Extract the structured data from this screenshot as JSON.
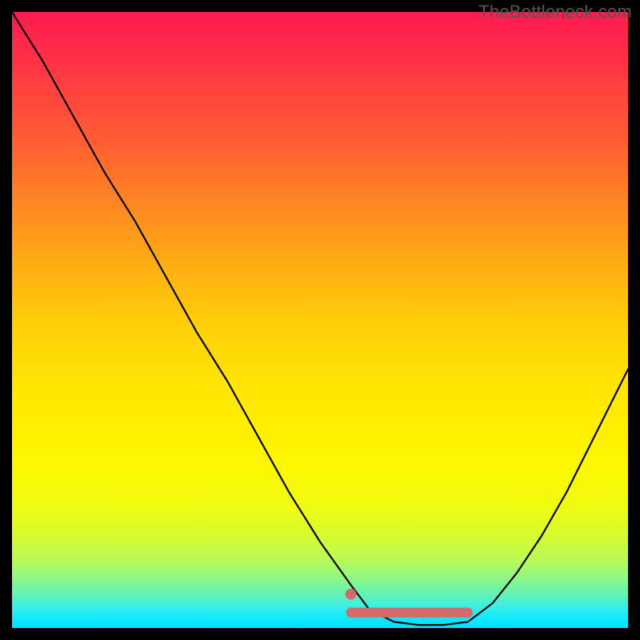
{
  "watermark": "TheBottleneck.com",
  "chart_data": {
    "type": "line",
    "title": "",
    "xlabel": "",
    "ylabel": "",
    "xlim": [
      0,
      100
    ],
    "ylim": [
      0,
      100
    ],
    "grid": false,
    "legend": false,
    "series": [
      {
        "name": "bottleneck-curve",
        "color": "#000000",
        "x": [
          0,
          5,
          10,
          15,
          20,
          25,
          30,
          35,
          40,
          45,
          50,
          55,
          58,
          62,
          66,
          70,
          74,
          78,
          82,
          86,
          90,
          94,
          98,
          100
        ],
        "y": [
          100,
          92,
          83,
          74,
          66,
          57,
          48,
          40,
          31,
          22,
          14,
          7,
          3,
          1,
          0.5,
          0.5,
          1,
          4,
          9,
          15,
          22,
          30,
          38,
          42
        ]
      }
    ],
    "optimal_band": {
      "name": "optimal-range",
      "color": "#d46a6a",
      "x_start": 55,
      "x_end": 74,
      "y": 2.5
    },
    "marker_point": {
      "name": "selected-point",
      "color": "#d46a6a",
      "x": 55,
      "y": 5.5,
      "radius": 5
    },
    "background_gradient": {
      "type": "vertical",
      "stops": [
        {
          "pos": 0,
          "color": "#ff1a50"
        },
        {
          "pos": 50,
          "color": "#ffd000"
        },
        {
          "pos": 80,
          "color": "#f0fb10"
        },
        {
          "pos": 100,
          "color": "#00e0ff"
        }
      ]
    }
  }
}
